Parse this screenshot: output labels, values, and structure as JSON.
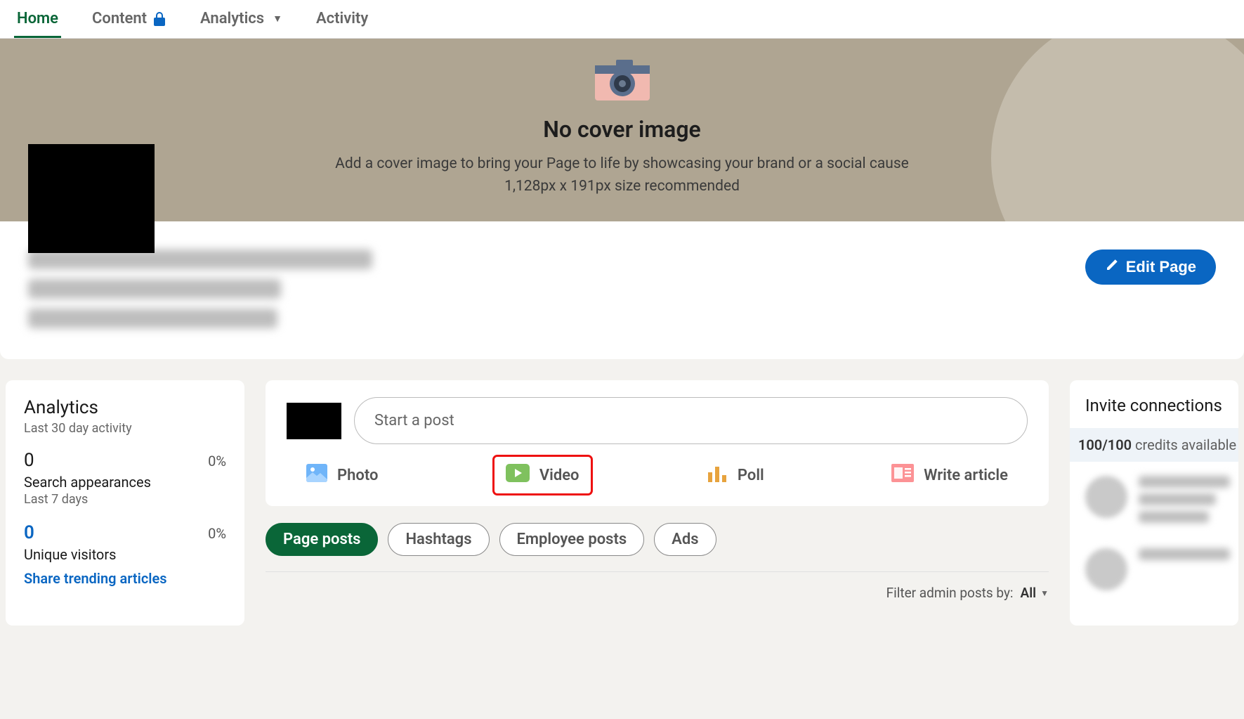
{
  "tabs": {
    "home": "Home",
    "content": "Content",
    "analytics": "Analytics",
    "activity": "Activity"
  },
  "cover": {
    "title": "No cover image",
    "subtitle": "Add a cover image to bring your Page to life by showcasing your brand or a social cause",
    "size_hint": "1,128px x 191px size recommended"
  },
  "edit_button": "Edit Page",
  "analytics_panel": {
    "title": "Analytics",
    "subtitle": "Last 30 day activity",
    "search_appearances": {
      "value": "0",
      "pct": "0%",
      "label": "Search appearances",
      "sublabel": "Last 7 days"
    },
    "unique_visitors": {
      "value": "0",
      "pct": "0%",
      "label": "Unique visitors"
    },
    "share_link": "Share trending articles"
  },
  "compose": {
    "placeholder": "Start a post",
    "actions": {
      "photo": "Photo",
      "video": "Video",
      "poll": "Poll",
      "article": "Write article"
    }
  },
  "post_filters": {
    "page_posts": "Page posts",
    "hashtags": "Hashtags",
    "employee_posts": "Employee posts",
    "ads": "Ads"
  },
  "admin_filter": {
    "label": "Filter admin posts by:",
    "value": "All"
  },
  "invite": {
    "title": "Invite connections",
    "credits_strong": "100/100",
    "credits_rest": " credits available"
  },
  "colors": {
    "brand_green": "#0a6638",
    "brand_blue": "#0a66c2"
  }
}
